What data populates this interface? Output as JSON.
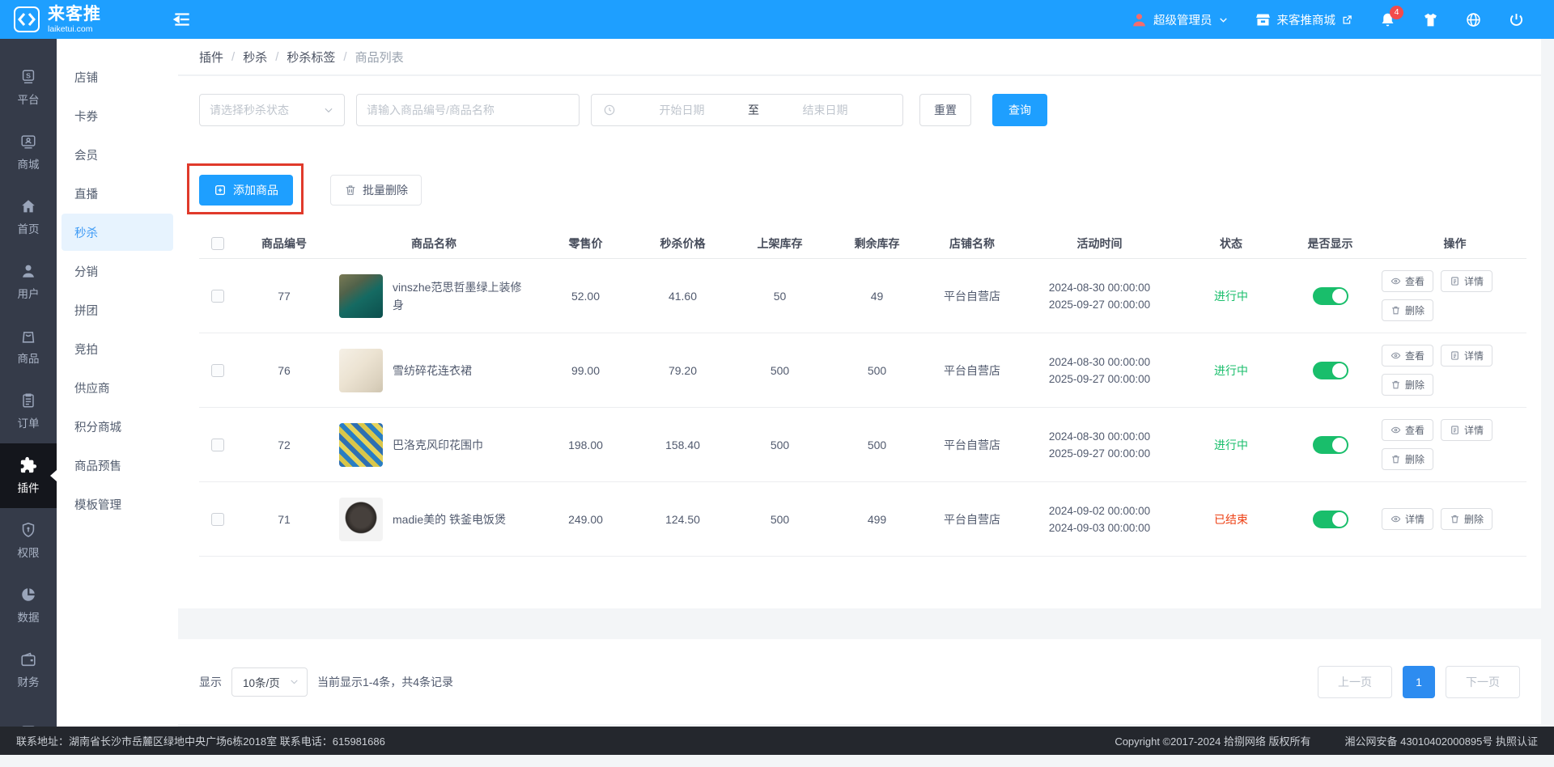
{
  "header": {
    "brand_title": "来客推",
    "brand_subtitle": "laiketui.com",
    "user_role": "超级管理员",
    "mall_label": "来客推商城",
    "notification_count": "4"
  },
  "icon_rail": {
    "items": [
      {
        "label": "平台"
      },
      {
        "label": "商城"
      },
      {
        "label": "首页"
      },
      {
        "label": "用户"
      },
      {
        "label": "商品"
      },
      {
        "label": "订单"
      },
      {
        "label": "插件"
      },
      {
        "label": "权限"
      },
      {
        "label": "数据"
      },
      {
        "label": "财务"
      },
      {
        "label": ""
      }
    ]
  },
  "sidebar": {
    "items": [
      "店铺",
      "卡券",
      "会员",
      "直播",
      "秒杀",
      "分销",
      "拼团",
      "竞拍",
      "供应商",
      "积分商城",
      "商品预售",
      "模板管理"
    ]
  },
  "breadcrumb": {
    "separator": "/",
    "items": [
      "插件",
      "秒杀",
      "秒杀标签",
      "商品列表"
    ]
  },
  "filters": {
    "status_placeholder": "请选择秒杀状态",
    "keyword_placeholder": "请输入商品编号/商品名称",
    "date_start": "开始日期",
    "date_to": "至",
    "date_end": "结束日期",
    "reset": "重置",
    "search": "查询"
  },
  "toolbar": {
    "add_product": "添加商品",
    "batch_delete": "批量删除"
  },
  "table": {
    "headers": [
      "商品编号",
      "商品名称",
      "零售价",
      "秒杀价格",
      "上架库存",
      "剩余库存",
      "店铺名称",
      "活动时间",
      "状态",
      "是否显示",
      "操作"
    ],
    "rows": [
      {
        "product_id": "77",
        "product_name": "vinszhe范思哲墨绿上装修身",
        "retail_price": "52.00",
        "seckill_price": "41.60",
        "listed_stock": "50",
        "remaining_stock": "49",
        "store_name": "平台自营店",
        "start_time": "2024-08-30 00:00:00",
        "end_time": "2025-09-27 00:00:00",
        "status": "进行中",
        "actions": {
          "view": "查看",
          "detail": "详情",
          "delete": "删除"
        }
      },
      {
        "product_id": "76",
        "product_name": "雪纺碎花连衣裙",
        "retail_price": "99.00",
        "seckill_price": "79.20",
        "listed_stock": "500",
        "remaining_stock": "500",
        "store_name": "平台自营店",
        "start_time": "2024-08-30 00:00:00",
        "end_time": "2025-09-27 00:00:00",
        "status": "进行中",
        "actions": {
          "view": "查看",
          "detail": "详情",
          "delete": "删除"
        }
      },
      {
        "product_id": "72",
        "product_name": "巴洛克风印花围巾",
        "retail_price": "198.00",
        "seckill_price": "158.40",
        "listed_stock": "500",
        "remaining_stock": "500",
        "store_name": "平台自营店",
        "start_time": "2024-08-30 00:00:00",
        "end_time": "2025-09-27 00:00:00",
        "status": "进行中",
        "actions": {
          "view": "查看",
          "detail": "详情",
          "delete": "删除"
        }
      },
      {
        "product_id": "71",
        "product_name": "madie美的 铁釜电饭煲",
        "retail_price": "249.00",
        "seckill_price": "124.50",
        "listed_stock": "500",
        "remaining_stock": "499",
        "store_name": "平台自营店",
        "start_time": "2024-09-02 00:00:00",
        "end_time": "2024-09-03 00:00:00",
        "status": "已结束",
        "actions": {
          "detail": "详情",
          "delete": "删除"
        }
      }
    ]
  },
  "pagination": {
    "display_label": "显示",
    "page_size": "10条/页",
    "summary": "当前显示1-4条，共4条记录",
    "prev": "上一页",
    "current_page": "1",
    "next": "下一页"
  },
  "footer": {
    "contact": "联系地址：湖南省长沙市岳麓区绿地中央广场6栋2018室 联系电话：615981686",
    "copyright": "Copyright ©2017-2024 拾捌网络 版权所有",
    "icp": "湘公网安备 43010402000895号 执照认证"
  },
  "colors": {
    "primary": "#1e9fff",
    "success": "#19be6b",
    "danger": "#ed4014",
    "annotation": "#e03a2b"
  }
}
